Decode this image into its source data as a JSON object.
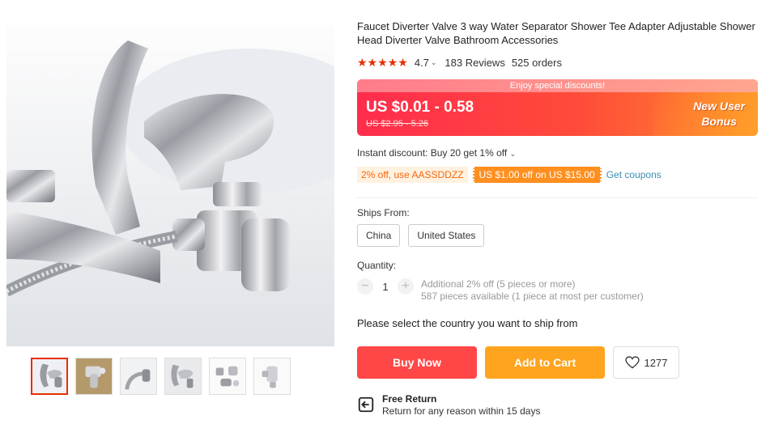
{
  "product": {
    "title": "Faucet Diverter Valve 3 way Water Separator Shower Tee Adapter Adjustable Shower Head Diverter Valve Bathroom Accessories",
    "stars": "★★★★★",
    "rating": "4.7",
    "reviews": "183 Reviews",
    "orders": "525 orders"
  },
  "price": {
    "banner": "Enjoy special discounts!",
    "current": "US $0.01 - 0.58",
    "original": "US $2.95 - 5.26",
    "promo_line1": "New User",
    "promo_line2": "Bonus"
  },
  "discount": {
    "instant": "Instant discount: Buy 20 get 1% off",
    "coupon_code": "2% off, use AASSDDZZ",
    "coupon_offer": "US $1.00 off on US $15.00",
    "get_coupons": "Get coupons"
  },
  "shipping": {
    "label": "Ships From:",
    "options": [
      "China",
      "United States"
    ],
    "note": "Please select the country you want to ship from"
  },
  "quantity": {
    "label": "Quantity:",
    "value": "1",
    "minus": "−",
    "plus": "+",
    "info_line1": "Additional 2% off (5 pieces or more)",
    "info_line2": "587 pieces available (1 piece at most per customer)"
  },
  "actions": {
    "buy_now": "Buy Now",
    "add_to_cart": "Add to Cart",
    "wishlist_count": "1277"
  },
  "returns": {
    "title": "Free Return",
    "subtitle": "Return for any reason within 15 days"
  },
  "colors": {
    "accent": "#ff4747",
    "cart": "#ffa41e",
    "star": "#e62e04",
    "link": "#3a8fb5"
  },
  "icons": [
    "heart-icon",
    "return-icon",
    "chevron-down-icon"
  ]
}
